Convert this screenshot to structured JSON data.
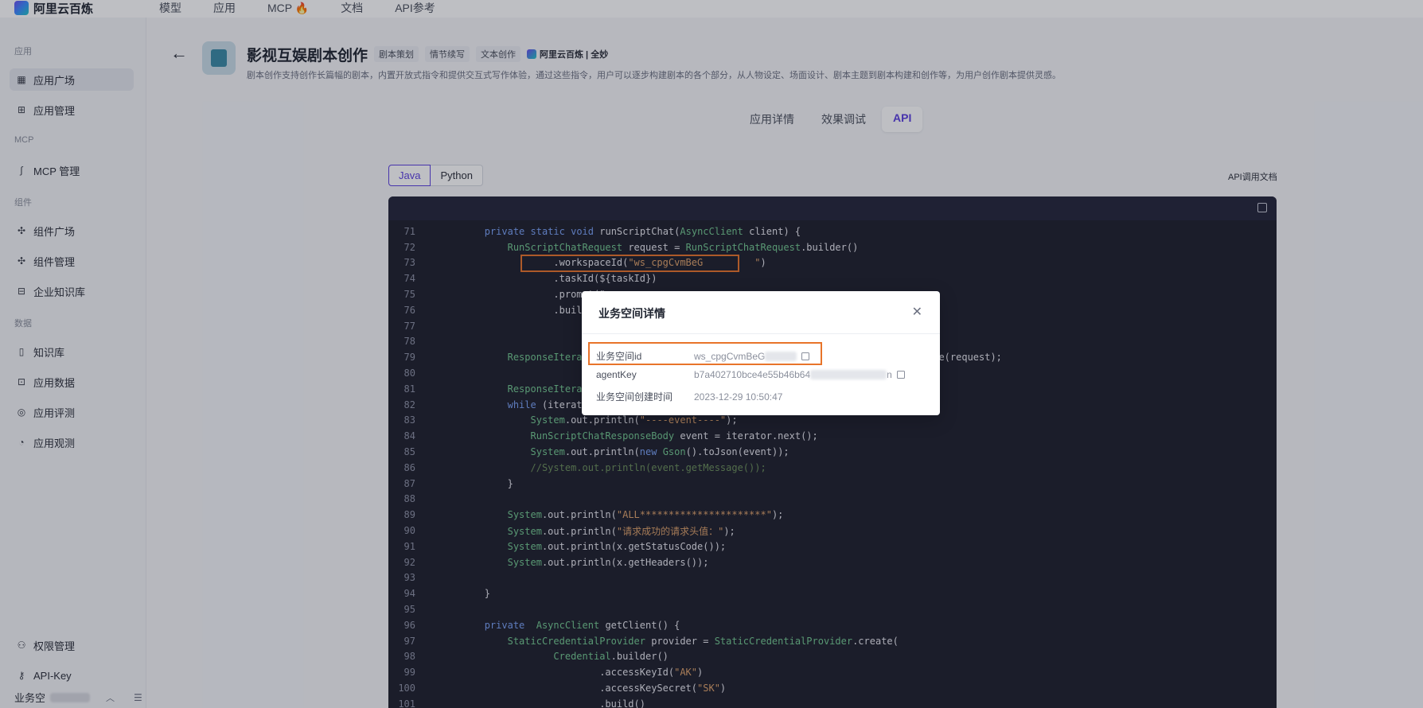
{
  "topbar": {
    "logo_text": "阿里云百炼",
    "nav": [
      "模型",
      "应用",
      "MCP 🔥",
      "文档",
      "API参考"
    ]
  },
  "sidebar": {
    "sections": [
      {
        "title": "应用",
        "items": [
          {
            "label": "应用广场",
            "icon": "grid-icon"
          },
          {
            "label": "应用管理",
            "icon": "apps-icon"
          }
        ]
      },
      {
        "title": "MCP",
        "items": [
          {
            "label": "MCP 管理",
            "icon": "mcp-icon"
          }
        ]
      },
      {
        "title": "组件",
        "items": [
          {
            "label": "组件广场",
            "icon": "puzzle-icon"
          },
          {
            "label": "组件管理",
            "icon": "puzzle-icon"
          },
          {
            "label": "企业知识库",
            "icon": "inbox-icon"
          }
        ]
      },
      {
        "title": "数据",
        "items": [
          {
            "label": "知识库",
            "icon": "book-icon"
          },
          {
            "label": "应用数据",
            "icon": "chart-icon"
          },
          {
            "label": "应用评测",
            "icon": "compass-icon"
          },
          {
            "label": "应用观测",
            "icon": "pie-icon"
          }
        ]
      }
    ],
    "bottom_items": [
      {
        "label": "权限管理",
        "icon": "user-icon"
      },
      {
        "label": "API-Key",
        "icon": "key-icon"
      }
    ],
    "workspace_label": "业务空"
  },
  "header": {
    "title": "影视互娱剧本创作",
    "tags": [
      "剧本策划",
      "情节续写",
      "文本创作"
    ],
    "brand": "阿里云百炼 | 全妙",
    "description": "剧本创作支持创作长篇幅的剧本，内置开放式指令和提供交互式写作体验，通过这些指令，用户可以逐步构建剧本的各个部分，从人物设定、场面设计、剧本主题到剧本构建和创作等，为用户创作剧本提供灵感。"
  },
  "tabs": [
    {
      "label": "应用详情",
      "active": false
    },
    {
      "label": "效果调试",
      "active": false
    },
    {
      "label": "API",
      "active": true
    }
  ],
  "lang_tabs": [
    {
      "label": "Java",
      "active": true
    },
    {
      "label": "Python",
      "active": false
    }
  ],
  "api_doc_link": "API调用文档",
  "code": {
    "lines": [
      {
        "n": "71",
        "t": "        private static void runScriptChat(AsyncClient client) {"
      },
      {
        "n": "72",
        "t": "            RunScriptChatRequest request = RunScriptChatRequest.builder()"
      },
      {
        "n": "73",
        "t": "                    .workspaceId(\"ws_cpgCvmBeG         \")"
      },
      {
        "n": "74",
        "t": "                    .taskId(${taskId})"
      },
      {
        "n": "75",
        "t": "                    .prompt(\""
      },
      {
        "n": "76",
        "t": "                    .build();"
      },
      {
        "n": "77",
        "t": ""
      },
      {
        "n": "78",
        "t": ""
      },
      {
        "n": "79",
        "t": "            ResponseIterable<                                                    terable(request);"
      },
      {
        "n": "80",
        "t": ""
      },
      {
        "n": "81",
        "t": "            ResponseIterator<"
      },
      {
        "n": "82",
        "t": "            while (iterator.h"
      },
      {
        "n": "83",
        "t": "                System.out.println(\"----event----\");"
      },
      {
        "n": "84",
        "t": "                RunScriptChatResponseBody event = iterator.next();"
      },
      {
        "n": "85",
        "t": "                System.out.println(new Gson().toJson(event));"
      },
      {
        "n": "86",
        "t": "                //System.out.println(event.getMessage());"
      },
      {
        "n": "87",
        "t": "            }"
      },
      {
        "n": "88",
        "t": ""
      },
      {
        "n": "89",
        "t": "            System.out.println(\"ALL**********************\");"
      },
      {
        "n": "90",
        "t": "            System.out.println(\"请求成功的请求头值：\");"
      },
      {
        "n": "91",
        "t": "            System.out.println(x.getStatusCode());"
      },
      {
        "n": "92",
        "t": "            System.out.println(x.getHeaders());"
      },
      {
        "n": "93",
        "t": ""
      },
      {
        "n": "94",
        "t": "        }"
      },
      {
        "n": "95",
        "t": ""
      },
      {
        "n": "96",
        "t": "        private  AsyncClient getClient() {"
      },
      {
        "n": "97",
        "t": "            StaticCredentialProvider provider = StaticCredentialProvider.create("
      },
      {
        "n": "98",
        "t": "                    Credential.builder()"
      },
      {
        "n": "99",
        "t": "                            .accessKeyId(\"AK\")"
      },
      {
        "n": "100",
        "t": "                            .accessKeySecret(\"SK\")"
      },
      {
        "n": "101",
        "t": "                            .build()"
      }
    ]
  },
  "modal": {
    "title": "业务空间详情",
    "rows": [
      {
        "label": "业务空间id",
        "value": "ws_cpgCvmBeG",
        "copy": true
      },
      {
        "label": "agentKey",
        "value": "b7a402710bce4e55b46b64",
        "value_tail": "n",
        "copy": true
      },
      {
        "label": "业务空间创建时间",
        "value": "2023-12-29 10:50:47",
        "copy": false
      }
    ]
  },
  "colors": {
    "accent": "#5b3fe0",
    "highlight": "#e8742a",
    "code_bg": "#1e1f2b"
  }
}
